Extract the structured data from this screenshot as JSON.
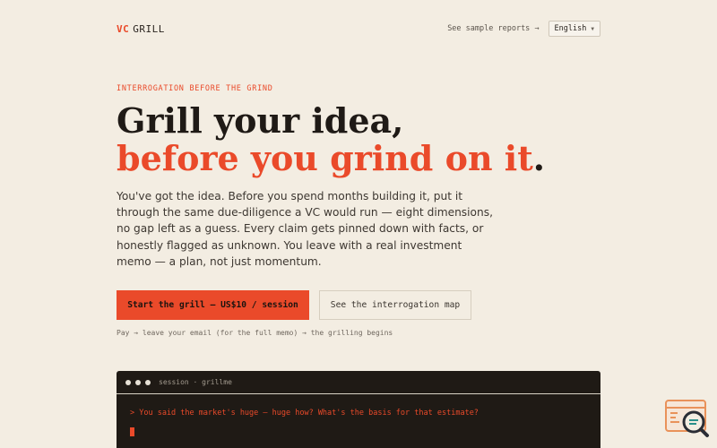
{
  "header": {
    "logo_prefix": "VC",
    "logo_name": "GRILL",
    "sample_link": "See sample reports →",
    "language": "English"
  },
  "hero": {
    "eyebrow": "INTERROGATION BEFORE THE GRIND",
    "title_line1": "Grill your idea,",
    "title_line2": "before you grind on it",
    "title_period": ".",
    "lede": "You've got the idea. Before you spend months building it, put it through the same due-diligence a VC would run — eight dimensions, no gap left as a guess. Every claim gets pinned down with facts, or honestly flagged as unknown. You leave with a real investment memo — a plan, not just momentum."
  },
  "cta": {
    "primary": "Start the grill — US$10 / session",
    "secondary": "See the interrogation map",
    "flow_note": "Pay → leave your email (for the full memo) → the grilling begins"
  },
  "terminal": {
    "title": "session · grillme",
    "prompt_line": "> You said the market's huge — huge how? What's the basis for that estimate?"
  },
  "colors": {
    "background": "#f3ede2",
    "accent": "#ea4a2a",
    "terminal_bg": "#1f1a15"
  },
  "icons": {
    "chat_widget": "search-chat-widget-icon"
  }
}
